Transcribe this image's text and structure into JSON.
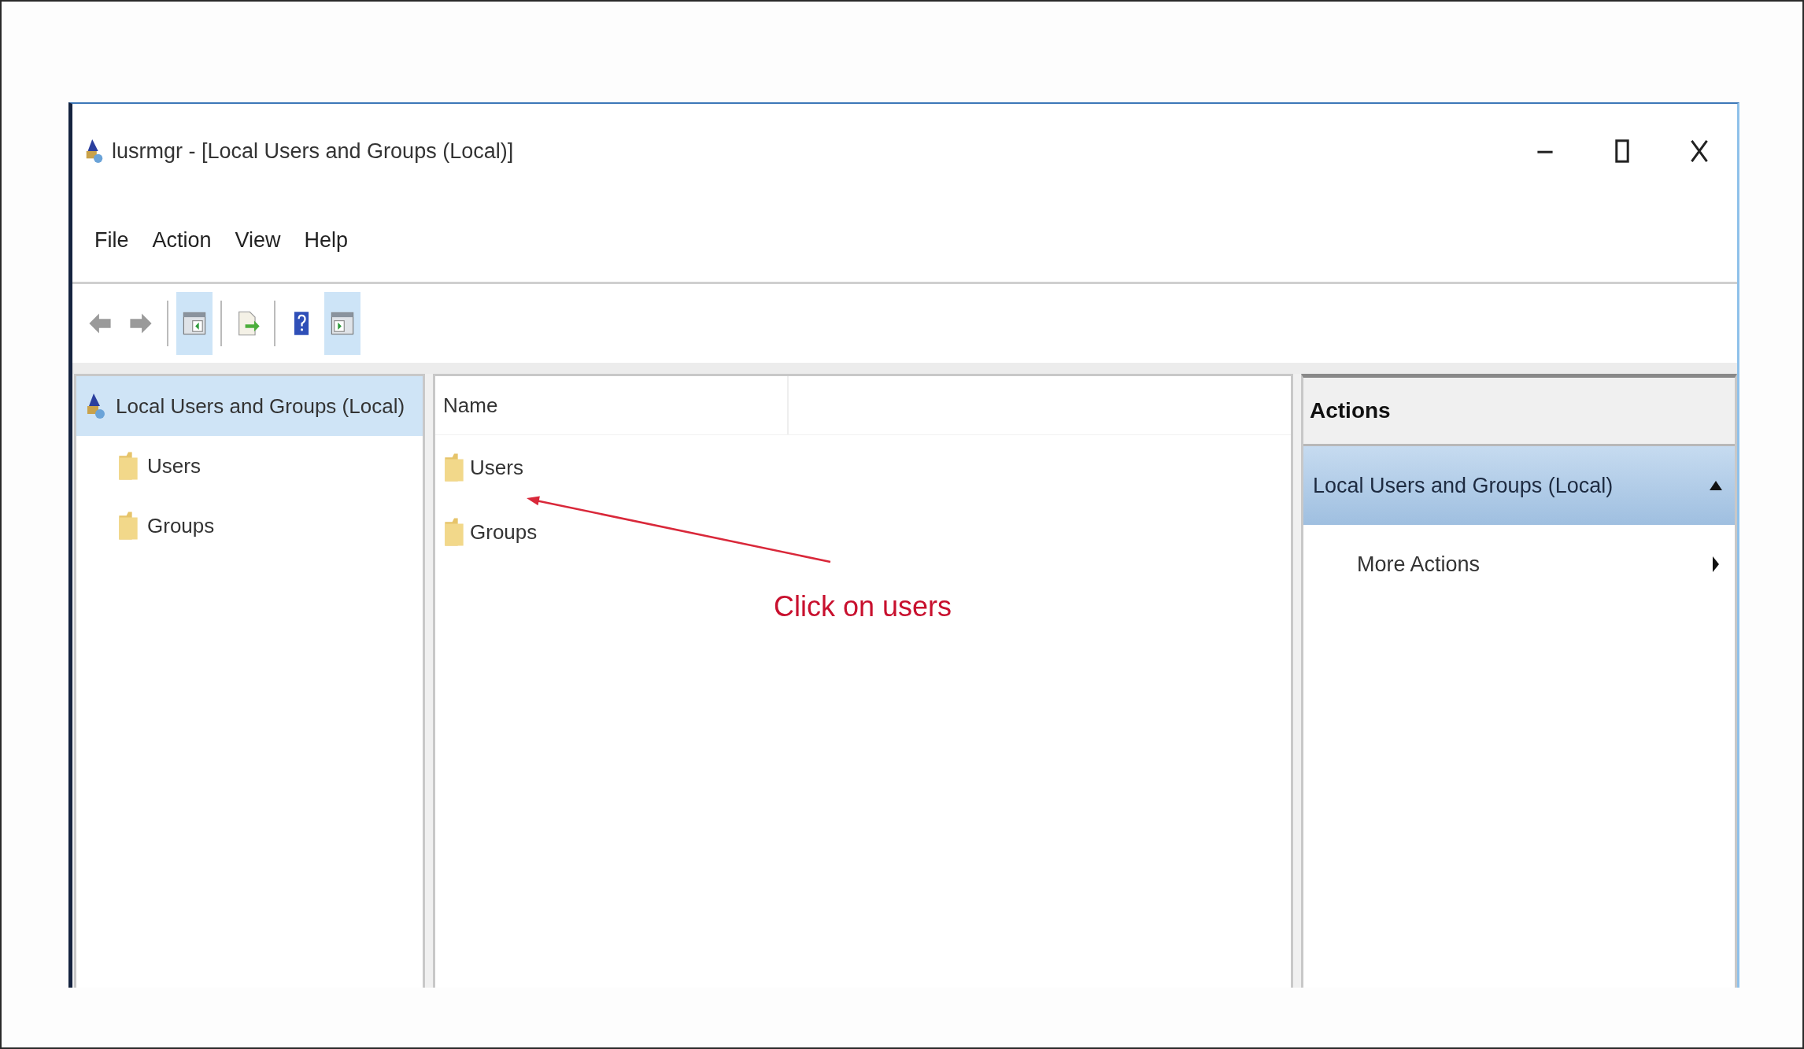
{
  "window": {
    "title": "lusrmgr - [Local Users and Groups (Local)]"
  },
  "menu": [
    "File",
    "Action",
    "View",
    "Help"
  ],
  "toolbar": [
    {
      "kind": "back",
      "disabled": true
    },
    {
      "kind": "forward",
      "disabled": true
    },
    {
      "kind": "separator"
    },
    {
      "kind": "tree-pane",
      "on": true
    },
    {
      "kind": "separator"
    },
    {
      "kind": "export",
      "on": false
    },
    {
      "kind": "separator"
    },
    {
      "kind": "help",
      "on": false
    },
    {
      "kind": "action-pane",
      "on": true
    }
  ],
  "tree": {
    "label": "Local Users and Groups (Local)",
    "selected": true,
    "children": [
      {
        "label": "Users",
        "selected": false
      },
      {
        "label": "Groups",
        "selected": false
      }
    ]
  },
  "list": {
    "columns": [
      "Name"
    ],
    "items": [
      {
        "name": "Users"
      },
      {
        "name": "Groups"
      }
    ]
  },
  "annotation": {
    "text": "Click on users"
  },
  "actions": {
    "header": "Actions",
    "group": {
      "title": "Local Users and Groups (Local)",
      "expanded": true,
      "items": [
        {
          "label": "More Actions"
        }
      ]
    }
  }
}
